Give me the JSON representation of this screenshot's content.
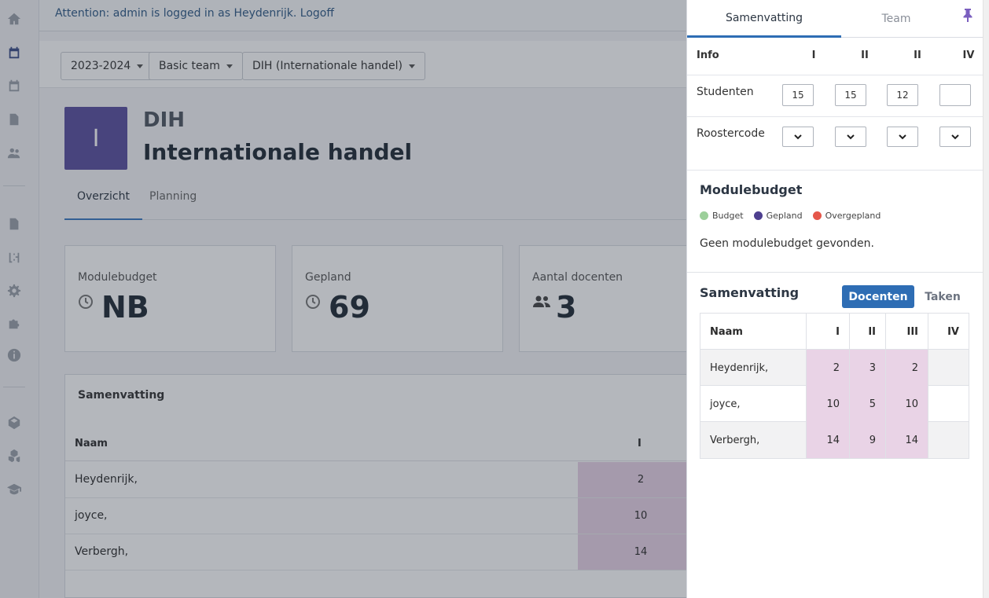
{
  "attention": {
    "text": "Attention: admin is logged in as Heydenrijk. Logoff"
  },
  "filters": {
    "year": "2023-2024",
    "team": "Basic team",
    "module": "DIH (Internationale handel)"
  },
  "module": {
    "badge": "I",
    "code": "DIH",
    "name": "Internationale handel"
  },
  "tabs": [
    "Overzicht",
    "Planning"
  ],
  "cards": [
    {
      "label": "Modulebudget",
      "value": "NB",
      "icon": "clock-icon"
    },
    {
      "label": "Gepland",
      "value": "69",
      "icon": "clock-icon"
    },
    {
      "label": "Aantal docenten",
      "value": "3",
      "icon": "users-icon"
    }
  ],
  "summary": {
    "title": "Samenvatting",
    "headers": {
      "naam": "Naam",
      "col1": "I"
    },
    "rows": [
      {
        "name": "Heydenrijk,",
        "v1": "2"
      },
      {
        "name": "joyce,",
        "v1": "10"
      },
      {
        "name": "Verbergh,",
        "v1": "14"
      }
    ]
  },
  "panel": {
    "tabs": [
      "Samenvatting",
      "Team"
    ],
    "info": {
      "label": "Info",
      "headers": [
        "I",
        "II",
        "II",
        "IV"
      ],
      "studenten_label": "Studenten",
      "studenten": [
        "15",
        "15",
        "12",
        ""
      ],
      "roostercode_label": "Roostercode"
    },
    "modulebudget": {
      "title": "Modulebudget",
      "legend": [
        {
          "label": "Budget",
          "color": "#9ccf9a"
        },
        {
          "label": "Gepland",
          "color": "#4e3f8f"
        },
        {
          "label": "Overgepland",
          "color": "#e5574a"
        }
      ],
      "empty": "Geen modulebudget gevonden."
    },
    "samenvatting": {
      "title": "Samenvatting",
      "btn_docenten": "Docenten",
      "btn_taken": "Taken",
      "headers": [
        "Naam",
        "I",
        "II",
        "III",
        "IV"
      ],
      "rows": [
        {
          "name": "Heydenrijk,",
          "vals": [
            "2",
            "3",
            "2",
            ""
          ]
        },
        {
          "name": "joyce,",
          "vals": [
            "10",
            "5",
            "10",
            ""
          ]
        },
        {
          "name": "Verbergh,",
          "vals": [
            "14",
            "9",
            "14",
            ""
          ]
        }
      ]
    }
  }
}
